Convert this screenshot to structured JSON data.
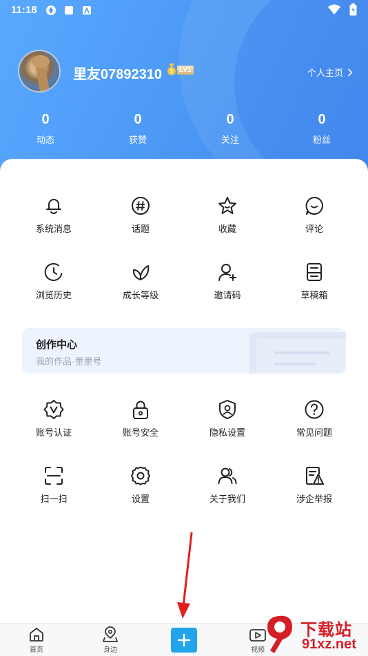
{
  "status_bar": {
    "time": "11:18"
  },
  "profile": {
    "username": "里友07892310",
    "level": "LV1",
    "homepage_link": "个人主页"
  },
  "stats": [
    {
      "value": "0",
      "label": "动态"
    },
    {
      "value": "0",
      "label": "获赞"
    },
    {
      "value": "0",
      "label": "关注"
    },
    {
      "value": "0",
      "label": "粉丝"
    }
  ],
  "menu_row1": [
    {
      "label": "系统消息",
      "icon": "bell-icon"
    },
    {
      "label": "话题",
      "icon": "hashtag-icon"
    },
    {
      "label": "收藏",
      "icon": "star-icon"
    },
    {
      "label": "评论",
      "icon": "comment-icon"
    }
  ],
  "menu_row2": [
    {
      "label": "浏览历史",
      "icon": "clock-icon"
    },
    {
      "label": "成长等级",
      "icon": "leaf-icon"
    },
    {
      "label": "邀请码",
      "icon": "add-user-icon"
    },
    {
      "label": "草稿箱",
      "icon": "drafts-icon"
    }
  ],
  "creator_center": {
    "title": "创作中心",
    "subtitle": "我的作品·里里号"
  },
  "menu_row3": [
    {
      "label": "账号认证",
      "icon": "verified-badge-icon"
    },
    {
      "label": "账号安全",
      "icon": "lock-icon"
    },
    {
      "label": "隐私设置",
      "icon": "privacy-shield-icon"
    },
    {
      "label": "常见问题",
      "icon": "question-icon"
    }
  ],
  "menu_row4": [
    {
      "label": "扫一扫",
      "icon": "scan-icon"
    },
    {
      "label": "设置",
      "icon": "gear-icon"
    },
    {
      "label": "关于我们",
      "icon": "people-icon"
    },
    {
      "label": "涉企举报",
      "icon": "report-icon"
    }
  ],
  "tab_bar": [
    {
      "label": "首页",
      "icon": "home-icon"
    },
    {
      "label": "身边",
      "icon": "location-icon"
    },
    {
      "label": "",
      "icon": "plus-icon"
    },
    {
      "label": "视频",
      "icon": "video-icon"
    }
  ],
  "watermark": {
    "top": "下载站",
    "bottom": "91xz.net"
  },
  "colors": {
    "header_blue": "#4a97f4",
    "accent": "#20a4ec",
    "annotation_arrow": "#e02020"
  }
}
